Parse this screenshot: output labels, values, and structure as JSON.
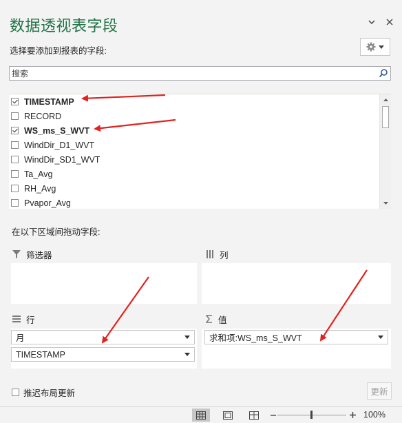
{
  "pane": {
    "title": "数据透视表字段",
    "subtitle": "选择要添加到报表的字段:",
    "search_placeholder": "搜索",
    "drag_label": "在以下区域间拖动字段:",
    "defer_label": "推迟布局更新",
    "update_label": "更新"
  },
  "fields": [
    {
      "label": "TIMESTAMP",
      "checked": true,
      "bold": true
    },
    {
      "label": "RECORD",
      "checked": false,
      "bold": false
    },
    {
      "label": "WS_ms_S_WVT",
      "checked": true,
      "bold": true
    },
    {
      "label": "WindDir_D1_WVT",
      "checked": false,
      "bold": false
    },
    {
      "label": "WindDir_SD1_WVT",
      "checked": false,
      "bold": false
    },
    {
      "label": "Ta_Avg",
      "checked": false,
      "bold": false
    },
    {
      "label": "RH_Avg",
      "checked": false,
      "bold": false
    },
    {
      "label": "Pvapor_Avg",
      "checked": false,
      "bold": false
    }
  ],
  "areas": {
    "filters": {
      "label": "筛选器",
      "items": []
    },
    "columns": {
      "label": "列",
      "items": []
    },
    "rows": {
      "label": "行",
      "items": [
        "月",
        "TIMESTAMP"
      ]
    },
    "values": {
      "label": "值",
      "items": [
        "求和项:WS_ms_S_WVT"
      ]
    }
  },
  "statusbar": {
    "zoom": "100%"
  },
  "colors": {
    "accent": "#217346",
    "arrow": "#e0231e",
    "pane_bg": "#f3f3f3"
  }
}
